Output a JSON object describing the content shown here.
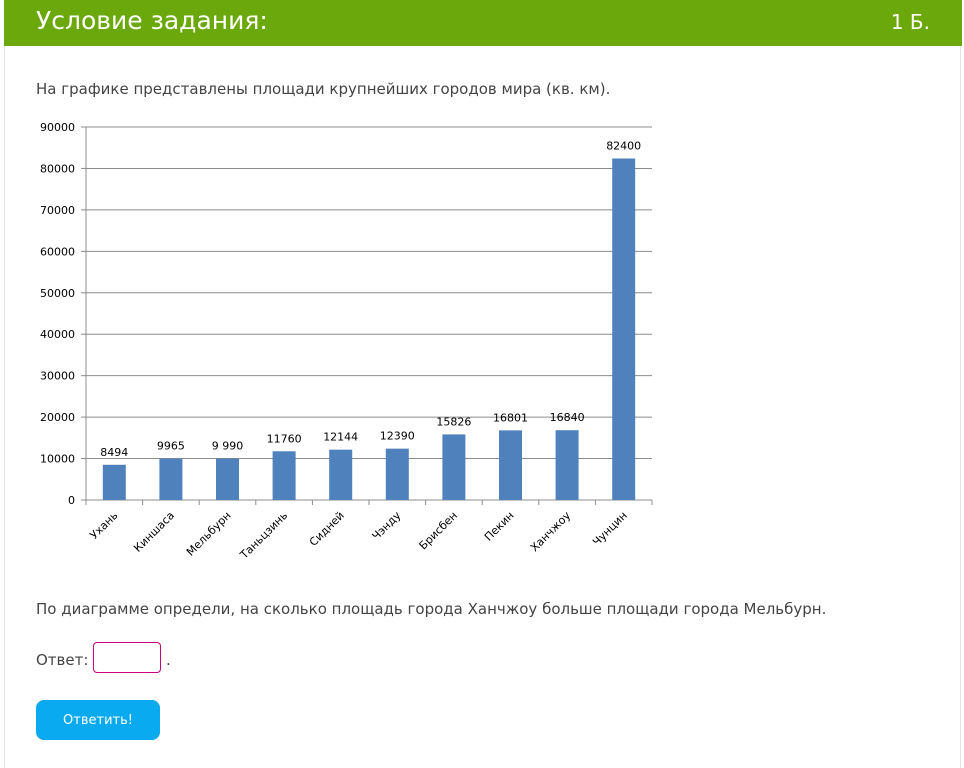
{
  "header": {
    "title": "Условие задания:",
    "score": "1 Б."
  },
  "question_text": "На графике представлены площади крупнейших городов мира (кв. км).",
  "chart_data": {
    "type": "bar",
    "categories": [
      "Ухань",
      "Киншаса",
      "Мельбурн",
      "Таньцзинь",
      "Сидней",
      "Чэнду",
      "Брисбен",
      "Пекин",
      "Ханчжоу",
      "Чунцин"
    ],
    "values": [
      8494,
      9965,
      9990,
      11760,
      12144,
      12390,
      15826,
      16801,
      16840,
      82400
    ],
    "data_labels": [
      "8494",
      "9965",
      "9 990",
      "11760",
      "12144",
      "12390",
      "15826",
      "16801",
      "16840",
      "82400"
    ],
    "y_ticks": [
      "0",
      "10000",
      "20000",
      "30000",
      "40000",
      "50000",
      "60000",
      "70000",
      "80000",
      "90000"
    ],
    "ylim": [
      0,
      90000
    ],
    "grid": true,
    "bar_color": "#4f81bd",
    "title": "",
    "xlabel": "",
    "ylabel": ""
  },
  "task_text": "По диаграмме определи, на сколько площадь города Ханчжоу больше площади города Мельбурн.",
  "answer": {
    "label": "Ответ:",
    "value": "",
    "suffix": "."
  },
  "submit_label": "Ответить!",
  "colors": {
    "header_bg": "#6aa80c",
    "input_border": "#c8007a",
    "button_bg": "#0aaaf0"
  }
}
